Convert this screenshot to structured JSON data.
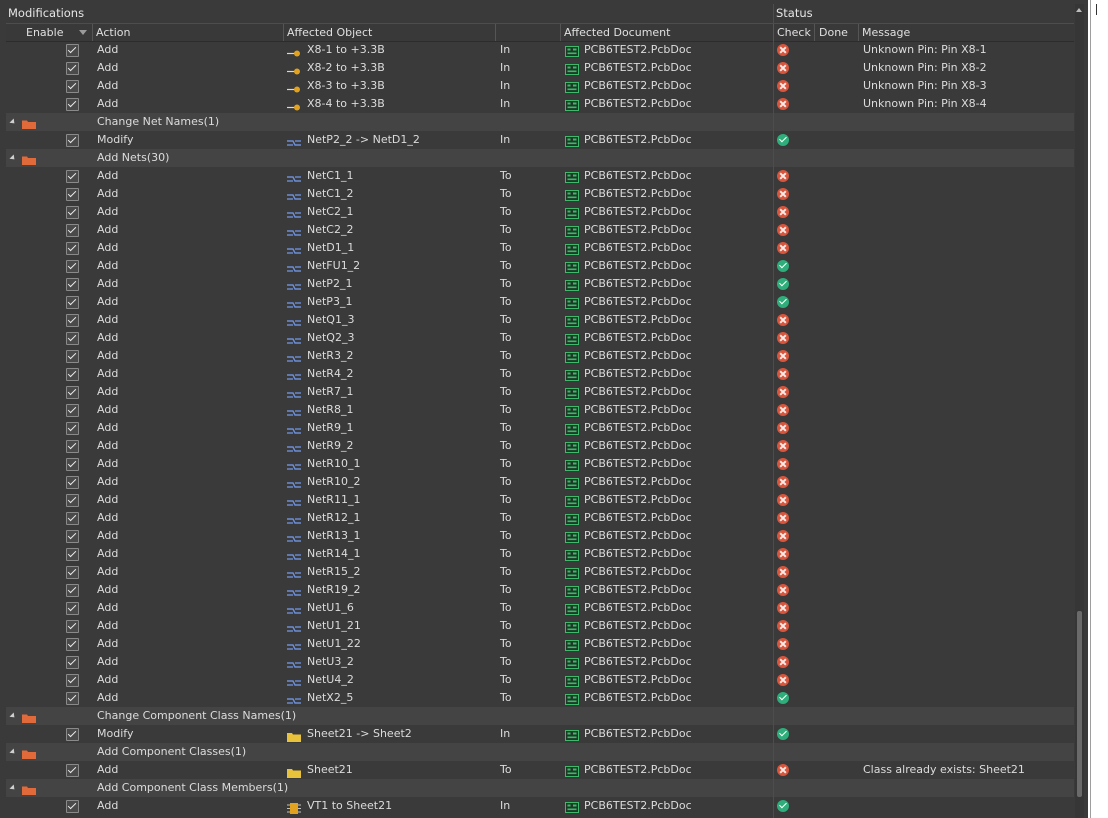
{
  "headers": {
    "modifications": "Modifications",
    "status": "Status",
    "enable": "Enable",
    "action": "Action",
    "affected_object": "Affected Object",
    "affected_document": "Affected Document",
    "check": "Check",
    "done": "Done",
    "message": "Message"
  },
  "colors": {
    "fail": "#d8553d",
    "ok": "#2fae7b",
    "background": "#3a3a3a",
    "group_row": "#444444",
    "folder": "#e06a3a",
    "net_icon": "#6c8fd8",
    "doc_icon": "#3fb86b"
  },
  "rows": [
    {
      "kind": "item",
      "enabled": true,
      "action": "Add",
      "icon": "pin-icon",
      "object": "X8-1 to +3.3В",
      "dir": "In",
      "document": "PCB6TEST2.PcbDoc",
      "check": "fail",
      "message": "Unknown Pin: Pin X8-1"
    },
    {
      "kind": "item",
      "enabled": true,
      "action": "Add",
      "icon": "pin-icon",
      "object": "X8-2 to +3.3В",
      "dir": "In",
      "document": "PCB6TEST2.PcbDoc",
      "check": "fail",
      "message": "Unknown Pin: Pin X8-2"
    },
    {
      "kind": "item",
      "enabled": true,
      "action": "Add",
      "icon": "pin-icon",
      "object": "X8-3 to +3.3В",
      "dir": "In",
      "document": "PCB6TEST2.PcbDoc",
      "check": "fail",
      "message": "Unknown Pin: Pin X8-3"
    },
    {
      "kind": "item",
      "enabled": true,
      "action": "Add",
      "icon": "pin-icon",
      "object": "X8-4 to +3.3В",
      "dir": "In",
      "document": "PCB6TEST2.PcbDoc",
      "check": "fail",
      "message": "Unknown Pin: Pin X8-4"
    },
    {
      "kind": "group",
      "label": "Change Net Names(1)"
    },
    {
      "kind": "item",
      "enabled": true,
      "action": "Modify",
      "icon": "net-icon",
      "object": "NetP2_2 -> NetD1_2",
      "dir": "In",
      "document": "PCB6TEST2.PcbDoc",
      "check": "ok",
      "message": ""
    },
    {
      "kind": "group",
      "label": "Add Nets(30)"
    },
    {
      "kind": "item",
      "enabled": true,
      "action": "Add",
      "icon": "net-icon",
      "object": "NetC1_1",
      "dir": "To",
      "document": "PCB6TEST2.PcbDoc",
      "check": "fail",
      "message": ""
    },
    {
      "kind": "item",
      "enabled": true,
      "action": "Add",
      "icon": "net-icon",
      "object": "NetC1_2",
      "dir": "To",
      "document": "PCB6TEST2.PcbDoc",
      "check": "fail",
      "message": ""
    },
    {
      "kind": "item",
      "enabled": true,
      "action": "Add",
      "icon": "net-icon",
      "object": "NetC2_1",
      "dir": "To",
      "document": "PCB6TEST2.PcbDoc",
      "check": "fail",
      "message": ""
    },
    {
      "kind": "item",
      "enabled": true,
      "action": "Add",
      "icon": "net-icon",
      "object": "NetC2_2",
      "dir": "To",
      "document": "PCB6TEST2.PcbDoc",
      "check": "fail",
      "message": ""
    },
    {
      "kind": "item",
      "enabled": true,
      "action": "Add",
      "icon": "net-icon",
      "object": "NetD1_1",
      "dir": "To",
      "document": "PCB6TEST2.PcbDoc",
      "check": "fail",
      "message": ""
    },
    {
      "kind": "item",
      "enabled": true,
      "action": "Add",
      "icon": "net-icon",
      "object": "NetFU1_2",
      "dir": "To",
      "document": "PCB6TEST2.PcbDoc",
      "check": "ok",
      "message": ""
    },
    {
      "kind": "item",
      "enabled": true,
      "action": "Add",
      "icon": "net-icon",
      "object": "NetP2_1",
      "dir": "To",
      "document": "PCB6TEST2.PcbDoc",
      "check": "ok",
      "message": ""
    },
    {
      "kind": "item",
      "enabled": true,
      "action": "Add",
      "icon": "net-icon",
      "object": "NetP3_1",
      "dir": "To",
      "document": "PCB6TEST2.PcbDoc",
      "check": "ok",
      "message": ""
    },
    {
      "kind": "item",
      "enabled": true,
      "action": "Add",
      "icon": "net-icon",
      "object": "NetQ1_3",
      "dir": "To",
      "document": "PCB6TEST2.PcbDoc",
      "check": "fail",
      "message": ""
    },
    {
      "kind": "item",
      "enabled": true,
      "action": "Add",
      "icon": "net-icon",
      "object": "NetQ2_3",
      "dir": "To",
      "document": "PCB6TEST2.PcbDoc",
      "check": "fail",
      "message": ""
    },
    {
      "kind": "item",
      "enabled": true,
      "action": "Add",
      "icon": "net-icon",
      "object": "NetR3_2",
      "dir": "To",
      "document": "PCB6TEST2.PcbDoc",
      "check": "fail",
      "message": ""
    },
    {
      "kind": "item",
      "enabled": true,
      "action": "Add",
      "icon": "net-icon",
      "object": "NetR4_2",
      "dir": "To",
      "document": "PCB6TEST2.PcbDoc",
      "check": "fail",
      "message": ""
    },
    {
      "kind": "item",
      "enabled": true,
      "action": "Add",
      "icon": "net-icon",
      "object": "NetR7_1",
      "dir": "To",
      "document": "PCB6TEST2.PcbDoc",
      "check": "fail",
      "message": ""
    },
    {
      "kind": "item",
      "enabled": true,
      "action": "Add",
      "icon": "net-icon",
      "object": "NetR8_1",
      "dir": "To",
      "document": "PCB6TEST2.PcbDoc",
      "check": "fail",
      "message": ""
    },
    {
      "kind": "item",
      "enabled": true,
      "action": "Add",
      "icon": "net-icon",
      "object": "NetR9_1",
      "dir": "To",
      "document": "PCB6TEST2.PcbDoc",
      "check": "fail",
      "message": ""
    },
    {
      "kind": "item",
      "enabled": true,
      "action": "Add",
      "icon": "net-icon",
      "object": "NetR9_2",
      "dir": "To",
      "document": "PCB6TEST2.PcbDoc",
      "check": "fail",
      "message": ""
    },
    {
      "kind": "item",
      "enabled": true,
      "action": "Add",
      "icon": "net-icon",
      "object": "NetR10_1",
      "dir": "To",
      "document": "PCB6TEST2.PcbDoc",
      "check": "fail",
      "message": ""
    },
    {
      "kind": "item",
      "enabled": true,
      "action": "Add",
      "icon": "net-icon",
      "object": "NetR10_2",
      "dir": "To",
      "document": "PCB6TEST2.PcbDoc",
      "check": "fail",
      "message": ""
    },
    {
      "kind": "item",
      "enabled": true,
      "action": "Add",
      "icon": "net-icon",
      "object": "NetR11_1",
      "dir": "To",
      "document": "PCB6TEST2.PcbDoc",
      "check": "fail",
      "message": ""
    },
    {
      "kind": "item",
      "enabled": true,
      "action": "Add",
      "icon": "net-icon",
      "object": "NetR12_1",
      "dir": "To",
      "document": "PCB6TEST2.PcbDoc",
      "check": "fail",
      "message": ""
    },
    {
      "kind": "item",
      "enabled": true,
      "action": "Add",
      "icon": "net-icon",
      "object": "NetR13_1",
      "dir": "To",
      "document": "PCB6TEST2.PcbDoc",
      "check": "fail",
      "message": ""
    },
    {
      "kind": "item",
      "enabled": true,
      "action": "Add",
      "icon": "net-icon",
      "object": "NetR14_1",
      "dir": "To",
      "document": "PCB6TEST2.PcbDoc",
      "check": "fail",
      "message": ""
    },
    {
      "kind": "item",
      "enabled": true,
      "action": "Add",
      "icon": "net-icon",
      "object": "NetR15_2",
      "dir": "To",
      "document": "PCB6TEST2.PcbDoc",
      "check": "fail",
      "message": ""
    },
    {
      "kind": "item",
      "enabled": true,
      "action": "Add",
      "icon": "net-icon",
      "object": "NetR19_2",
      "dir": "To",
      "document": "PCB6TEST2.PcbDoc",
      "check": "fail",
      "message": ""
    },
    {
      "kind": "item",
      "enabled": true,
      "action": "Add",
      "icon": "net-icon",
      "object": "NetU1_6",
      "dir": "To",
      "document": "PCB6TEST2.PcbDoc",
      "check": "fail",
      "message": ""
    },
    {
      "kind": "item",
      "enabled": true,
      "action": "Add",
      "icon": "net-icon",
      "object": "NetU1_21",
      "dir": "To",
      "document": "PCB6TEST2.PcbDoc",
      "check": "fail",
      "message": ""
    },
    {
      "kind": "item",
      "enabled": true,
      "action": "Add",
      "icon": "net-icon",
      "object": "NetU1_22",
      "dir": "To",
      "document": "PCB6TEST2.PcbDoc",
      "check": "fail",
      "message": ""
    },
    {
      "kind": "item",
      "enabled": true,
      "action": "Add",
      "icon": "net-icon",
      "object": "NetU3_2",
      "dir": "To",
      "document": "PCB6TEST2.PcbDoc",
      "check": "fail",
      "message": ""
    },
    {
      "kind": "item",
      "enabled": true,
      "action": "Add",
      "icon": "net-icon",
      "object": "NetU4_2",
      "dir": "To",
      "document": "PCB6TEST2.PcbDoc",
      "check": "fail",
      "message": ""
    },
    {
      "kind": "item",
      "enabled": true,
      "action": "Add",
      "icon": "net-icon",
      "object": "NetX2_5",
      "dir": "To",
      "document": "PCB6TEST2.PcbDoc",
      "check": "ok",
      "message": ""
    },
    {
      "kind": "group",
      "label": "Change Component Class Names(1)"
    },
    {
      "kind": "item",
      "enabled": true,
      "action": "Modify",
      "icon": "folder-icon",
      "object": "Sheet21 -> Sheet2",
      "dir": "In",
      "document": "PCB6TEST2.PcbDoc",
      "check": "ok",
      "message": ""
    },
    {
      "kind": "group",
      "label": "Add Component Classes(1)"
    },
    {
      "kind": "item",
      "enabled": true,
      "action": "Add",
      "icon": "folder-icon",
      "object": "Sheet21",
      "dir": "To",
      "document": "PCB6TEST2.PcbDoc",
      "check": "fail",
      "message": "Class already exists: Sheet21"
    },
    {
      "kind": "group",
      "label": "Add Component Class Members(1)"
    },
    {
      "kind": "item",
      "enabled": true,
      "action": "Add",
      "icon": "component-icon",
      "object": "VT1 to Sheet21",
      "dir": "In",
      "document": "PCB6TEST2.PcbDoc",
      "check": "ok",
      "message": ""
    }
  ]
}
